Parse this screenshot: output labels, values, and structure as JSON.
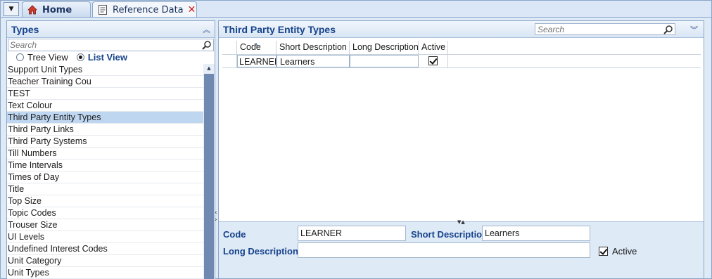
{
  "tabs": {
    "home_label": "Home",
    "ref_label": "Reference Data",
    "close_glyph": "✕"
  },
  "left_panel": {
    "title": "Types",
    "search_placeholder": "Search",
    "tree_view_label": "Tree View",
    "list_view_label": "List View",
    "selected_view": "List View",
    "items": [
      "Support Unit Types",
      "Teacher Training Cou",
      "TEST",
      "Text Colour",
      "Third Party Entity Types",
      "Third Party Links",
      "Third Party Systems",
      "Till Numbers",
      "Time Intervals",
      "Times of Day",
      "Title",
      "Top Size",
      "Topic Codes",
      "Trouser Size",
      "UI Levels",
      "Undefined Interest Codes",
      "Unit Category",
      "Unit Types"
    ],
    "selected_item": "Third Party Entity Types"
  },
  "right_panel": {
    "title": "Third Party Entity Types",
    "search_placeholder": "Search",
    "grid": {
      "columns": [
        "Code",
        "Short Description",
        "Long Description",
        "Active"
      ],
      "rows": [
        {
          "code": "LEARNER",
          "short": "Learners",
          "long": "",
          "active": true
        }
      ]
    },
    "detail": {
      "code_label": "Code",
      "code_value": "LEARNER",
      "short_label": "Short Description",
      "short_value": "Learners",
      "long_label": "Long Description",
      "long_value": "",
      "active_label": "Active",
      "active": true
    }
  },
  "colors": {
    "accent_text": "#15428b",
    "selection": "#bed6f0",
    "close_red": "#d01c1c"
  }
}
